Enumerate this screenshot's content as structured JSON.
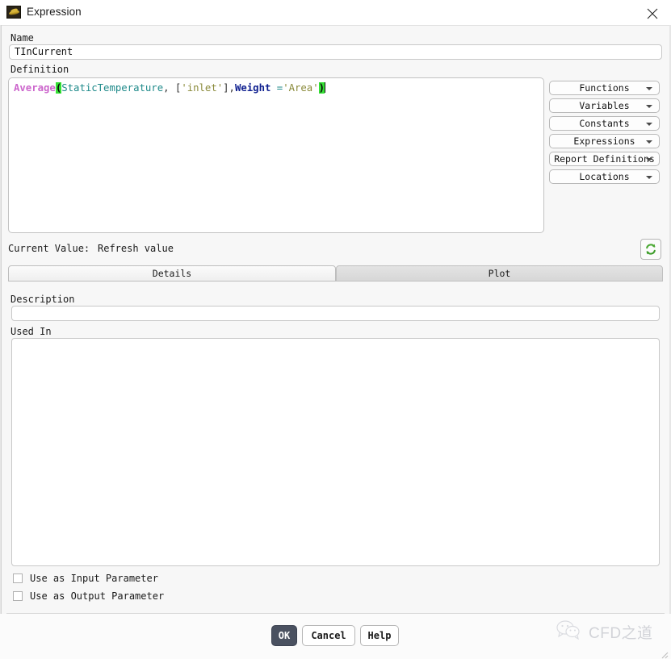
{
  "window": {
    "title": "Expression",
    "icon": "expression-icon",
    "close_icon": "close-icon"
  },
  "form": {
    "name_label": "Name",
    "name_value": "TInCurrent",
    "definition_label": "Definition",
    "definition_expression": "Average(StaticTemperature, ['inlet'],Weight ='Area')",
    "definition_tokens": [
      {
        "text": "Average",
        "type": "func"
      },
      {
        "text": "(",
        "type": "bracket"
      },
      {
        "text": "StaticTemperature",
        "type": "var"
      },
      {
        "text": ",",
        "type": "punct"
      },
      {
        "text": " [",
        "type": "punct"
      },
      {
        "text": "'inlet'",
        "type": "str"
      },
      {
        "text": "]",
        "type": "punct"
      },
      {
        "text": ",",
        "type": "punct"
      },
      {
        "text": "Weight",
        "type": "keyword"
      },
      {
        "text": " =",
        "type": "operator"
      },
      {
        "text": "'Area'",
        "type": "str"
      },
      {
        "text": ")",
        "type": "bracket"
      }
    ]
  },
  "insert_menus": [
    {
      "label": "Functions",
      "icon": "chevron-down-icon"
    },
    {
      "label": "Variables",
      "icon": "chevron-down-icon"
    },
    {
      "label": "Constants",
      "icon": "chevron-down-icon"
    },
    {
      "label": "Expressions",
      "icon": "chevron-down-icon"
    },
    {
      "label": "Report Definitions",
      "icon": "chevron-down-icon"
    },
    {
      "label": "Locations",
      "icon": "chevron-down-icon"
    }
  ],
  "current_value": {
    "label": "Current Value:",
    "value": "Refresh value",
    "refresh_icon": "refresh-icon"
  },
  "tabs": [
    {
      "label": "Details",
      "active": true
    },
    {
      "label": "Plot",
      "active": false
    }
  ],
  "details": {
    "description_label": "Description",
    "description_value": "",
    "description_placeholder": "",
    "used_in_label": "Used In",
    "used_in_items": []
  },
  "parameter_options": [
    {
      "label": "Use as Input Parameter",
      "checked": false
    },
    {
      "label": "Use as Output Parameter",
      "checked": false
    }
  ],
  "footer_buttons": [
    {
      "label": "OK",
      "primary": true
    },
    {
      "label": "Cancel",
      "primary": false
    },
    {
      "label": "Help",
      "primary": false
    }
  ],
  "watermark": {
    "text": "CFD之道",
    "icon": "wechat-icon"
  },
  "colors": {
    "primary_button": "#4a5160",
    "function_token": "#cc66cc",
    "variable_token": "#1f8a8a",
    "keyword_token": "#0e1f8f",
    "string_token": "#8a8a3a",
    "bracket_highlight": "#35e035",
    "refresh_icon": "#3c9c28"
  }
}
